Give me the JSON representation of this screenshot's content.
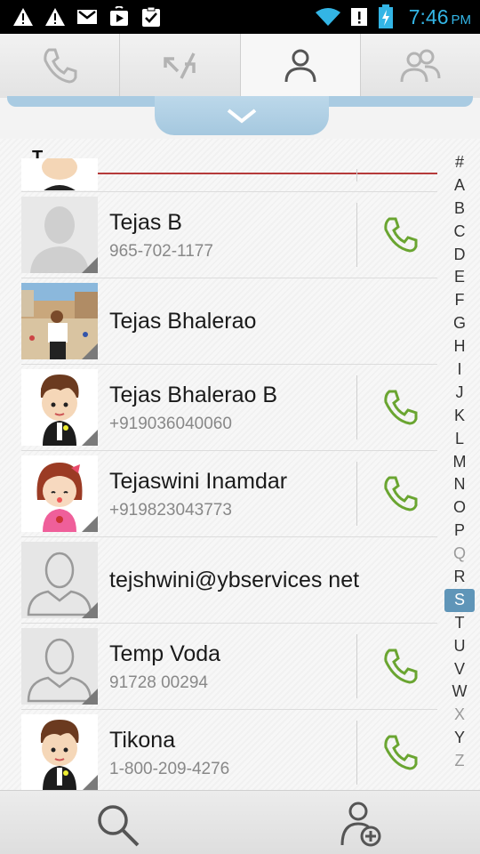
{
  "status_bar": {
    "time": "7:46",
    "ampm": "PM",
    "icons": [
      "warning-icon",
      "warning-icon",
      "gmail-icon",
      "play-store-icon",
      "clipboard-check-icon",
      "wifi-icon",
      "alert-icon",
      "battery-charging-icon"
    ]
  },
  "tabs": [
    {
      "name": "phone-icon",
      "active": false
    },
    {
      "name": "call-log-icon",
      "active": false
    },
    {
      "name": "contact-icon",
      "active": true
    },
    {
      "name": "groups-icon",
      "active": false
    }
  ],
  "section": {
    "letter": "T"
  },
  "contacts": [
    {
      "name": "Tejas B",
      "number": "965-702-1177",
      "avatar": "default-person-icon",
      "has_call": true
    },
    {
      "name": "Tejas Bhalerao",
      "number": "",
      "avatar": "photo-avatar",
      "has_call": false
    },
    {
      "name": "Tejas Bhalerao B",
      "number": "+919036040060",
      "avatar": "cartoon-boy-avatar",
      "has_call": true
    },
    {
      "name": "Tejaswini Inamdar",
      "number": "+919823043773",
      "avatar": "cartoon-girl-avatar",
      "has_call": true
    },
    {
      "name": "tejshwini@ybservices net",
      "number": "",
      "avatar": "outline-person-icon",
      "has_call": false
    },
    {
      "name": "Temp Voda",
      "number": "91728 00294",
      "avatar": "outline-person-icon",
      "has_call": true
    },
    {
      "name": "Tikona",
      "number": "1-800-209-4276",
      "avatar": "cartoon-boy-avatar",
      "has_call": true
    }
  ],
  "alphabet": [
    "#",
    "A",
    "B",
    "C",
    "D",
    "E",
    "F",
    "G",
    "H",
    "I",
    "J",
    "K",
    "L",
    "M",
    "N",
    "O",
    "P",
    "Q",
    "R",
    "S",
    "T",
    "U",
    "V",
    "W",
    "X",
    "Y",
    "Z"
  ],
  "alphabet_dim": [
    "Q",
    "X",
    "Z"
  ],
  "alphabet_selected": "S",
  "colors": {
    "accent": "#33b5e5",
    "call_green": "#6aa531",
    "section_line": "#b53a3a",
    "index_selected": "#5f95b8"
  },
  "bottom_bar": {
    "left": "search-icon",
    "right": "add-contact-icon"
  }
}
